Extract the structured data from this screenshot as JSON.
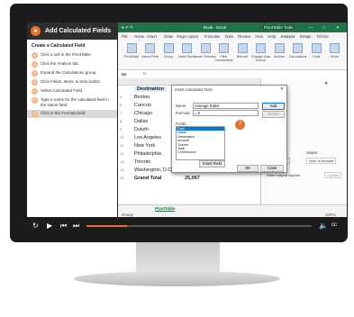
{
  "player": {
    "title": "Add Calculated Fields",
    "task_heading": "Create a Calculated Field",
    "steps": [
      {
        "num": "1",
        "text": "Click a cell in the PivotTable."
      },
      {
        "num": "2",
        "text": "Click the Analyze tab."
      },
      {
        "num": "3",
        "text": "Expand the Calculations group."
      },
      {
        "num": "4",
        "text": "Click Fields, Items, & Sets button."
      },
      {
        "num": "5",
        "text": "Select Calculated Field."
      },
      {
        "num": "6",
        "text": "Type a name for the calculated field in the Name field."
      },
      {
        "num": "7",
        "text": "Click in the Formula field."
      }
    ],
    "progress": 0.18,
    "cc_label": "cc"
  },
  "excel": {
    "title": "Book - Excel",
    "context_tab": "PivotTable Tools",
    "tabs": [
      "File",
      "Home",
      "Insert",
      "Draw",
      "Page Layout",
      "Formulas",
      "Data",
      "Review",
      "View",
      "Help",
      "Analyze",
      "Design",
      "Tell me"
    ],
    "active_tab": "Analyze",
    "ribbon": [
      "PivotTable",
      "Active Field",
      "Group",
      "Insert Slicer",
      "Insert Timeline",
      "Filter Connections",
      "Refresh",
      "Change Data Source",
      "Actions",
      "Calculations",
      "Tools",
      "Show"
    ],
    "namebox": "B5",
    "column_header": "Destination",
    "rows": [
      {
        "n": "5",
        "name": "Boston",
        "value": ""
      },
      {
        "n": "6",
        "name": "Cancun",
        "value": ""
      },
      {
        "n": "7",
        "name": "Chicago",
        "value": ""
      },
      {
        "n": "8",
        "name": "Dallas",
        "value": ""
      },
      {
        "n": "9",
        "name": "Duluth",
        "value": ""
      },
      {
        "n": "10",
        "name": "Los Angeles",
        "value": ""
      },
      {
        "n": "11",
        "name": "New York",
        "value": ""
      },
      {
        "n": "12",
        "name": "Philadelphia",
        "value": ""
      },
      {
        "n": "13",
        "name": "Toronto",
        "value": ""
      },
      {
        "n": "14",
        "name": "Washington, D.C.",
        "value": "2,793"
      },
      {
        "n": "15",
        "name": "Grand Total",
        "value": "25,067"
      }
    ],
    "sheet_tab": "PivotTable",
    "status": "Ready",
    "fields_pane": {
      "columns_label": "Columns",
      "rows_label": "Rows",
      "values_label": "Values",
      "rows_value": "Destination",
      "values_value": "Sum of Amount",
      "defer_label": "Defer Layout Update",
      "update_label": "Update"
    },
    "zoom": "100%"
  },
  "dialog": {
    "title": "Insert Calculated Field",
    "name_label": "Name:",
    "name_value": "Average Sales",
    "formula_label": "Formula:",
    "formula_value": "= 0",
    "fields_label": "Fields:",
    "fields": [
      "Date",
      "Name",
      "Destination",
      "Amount",
      "Tickets",
      "Total",
      "Commission"
    ],
    "selected_field": "Date",
    "add_label": "Add",
    "delete_label": "Delete",
    "insert_field_label": "Insert Field",
    "ok_label": "OK",
    "close_label": "Close",
    "step_marker": "7"
  }
}
